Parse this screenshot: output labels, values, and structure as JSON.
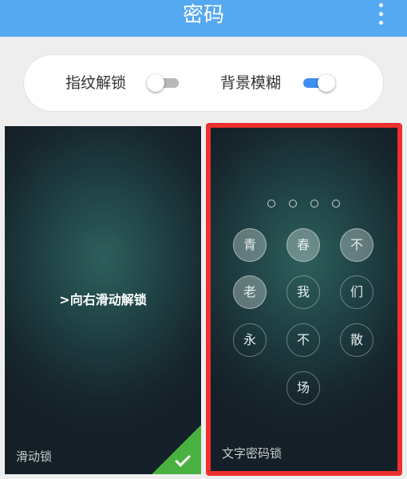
{
  "header": {
    "title": "密码"
  },
  "settings": {
    "fingerprint": {
      "label": "指纹解锁",
      "enabled": false
    },
    "blur_background": {
      "label": "背景模糊",
      "enabled": true
    }
  },
  "locks": {
    "slide": {
      "hint": ">向右滑动解锁",
      "caption": "滑动锁",
      "selected": true
    },
    "text": {
      "caption": "文字密码锁",
      "pin_length": 4,
      "keys": [
        {
          "char": "青",
          "active": true
        },
        {
          "char": "春",
          "active": true
        },
        {
          "char": "不",
          "active": true
        },
        {
          "char": "老",
          "active": true
        },
        {
          "char": "我",
          "active": false
        },
        {
          "char": "们",
          "active": false
        },
        {
          "char": "永",
          "active": false
        },
        {
          "char": "不",
          "active": false
        },
        {
          "char": "散",
          "active": false
        },
        {
          "char": "场",
          "active": false
        }
      ]
    }
  },
  "colors": {
    "header": "#55a9f0",
    "switch_on": "#3f8ef3",
    "selected_frame": "#ee3030",
    "check": "#49b140"
  }
}
